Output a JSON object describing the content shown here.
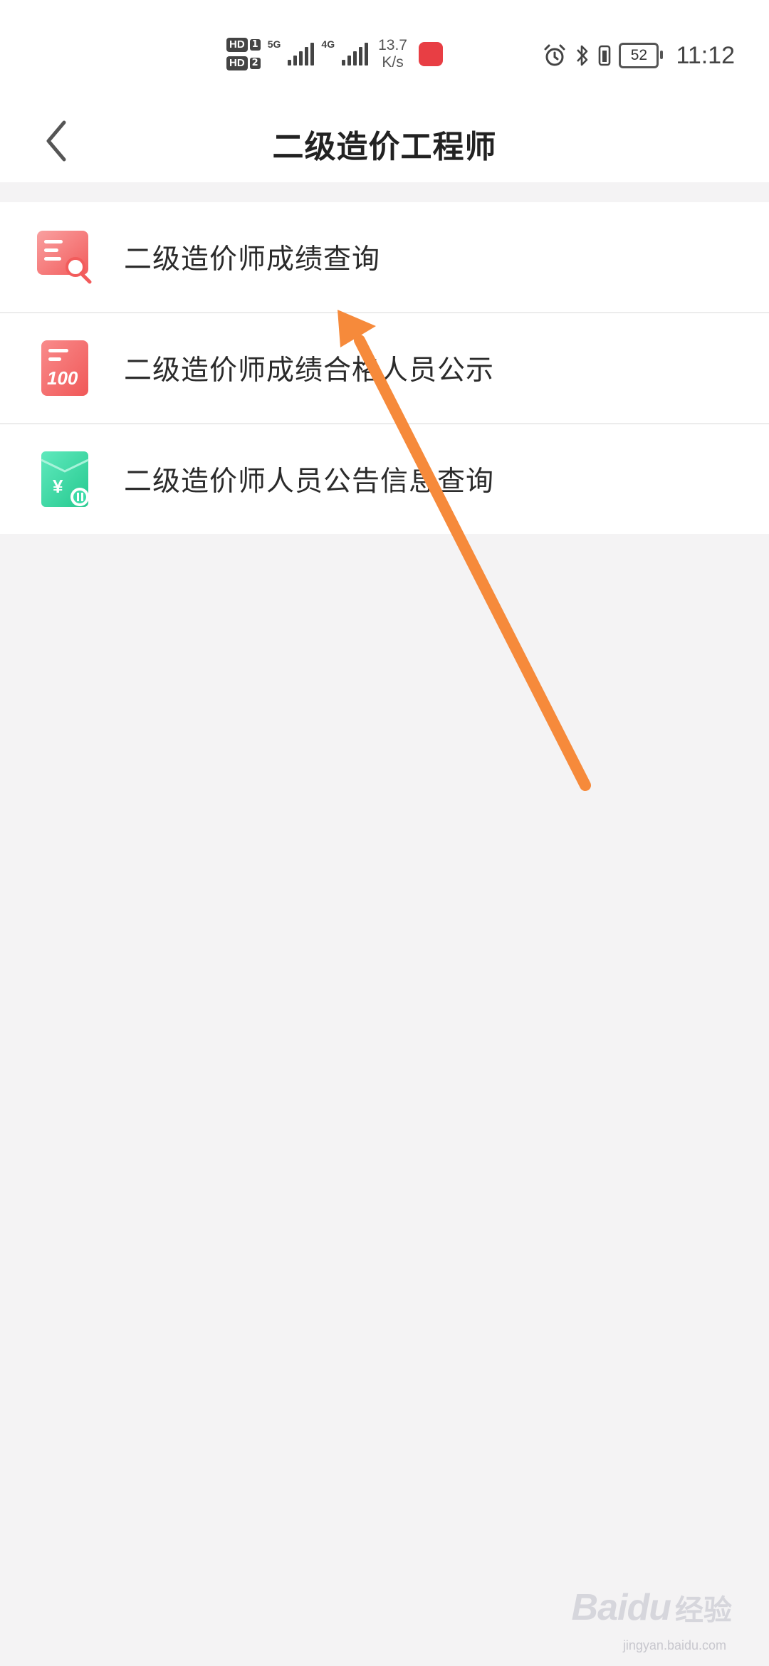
{
  "status_bar": {
    "sim1": "HD",
    "sim1_index": "1",
    "sim2": "HD",
    "sim2_index": "2",
    "net1": "5G",
    "net2": "4G",
    "speed_value": "13.7",
    "speed_unit": "K/s",
    "battery": "52",
    "time": "11:12",
    "icons": [
      "alarm-icon",
      "bluetooth-icon",
      "vibrate-icon",
      "battery-icon"
    ]
  },
  "header": {
    "title": "二级造价工程师",
    "back_icon": "chevron-left-icon"
  },
  "menu": {
    "items": [
      {
        "label": "二级造价师成绩查询",
        "icon": "score-search-icon",
        "icon_color": "#f36b6b"
      },
      {
        "label": "二级造价师成绩合格人员公示",
        "icon": "score-100-icon",
        "icon_color": "#f36b6b"
      },
      {
        "label": "二级造价师人员公告信息查询",
        "icon": "yuan-notice-icon",
        "icon_color": "#3ddba8"
      }
    ]
  },
  "annotation": {
    "arrow_color": "#f68a3b"
  },
  "watermark": {
    "brand": "Baidu",
    "text": "经验",
    "site": "jingyan.baidu.com"
  }
}
